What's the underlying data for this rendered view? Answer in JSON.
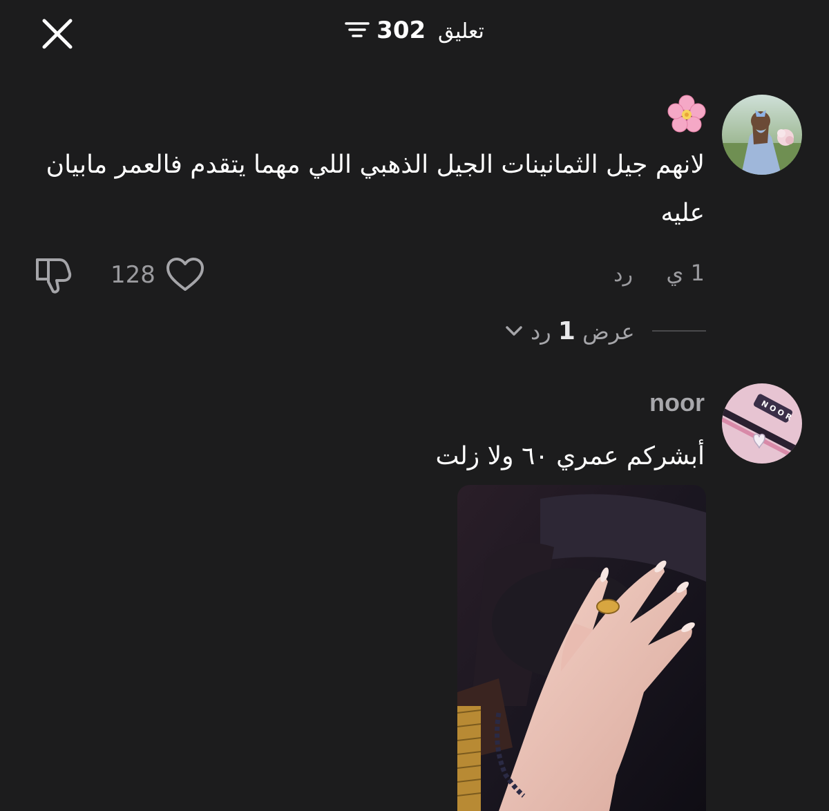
{
  "header": {
    "count": "302",
    "title_word": "تعليق"
  },
  "comments": [
    {
      "emoji": "🌸",
      "text": "لانهم جيل الثمانينات الجيل الذهبي اللي مهما يتقدم فالعمر مابيان عليه",
      "time": "1 ي",
      "reply_label": "رد",
      "like_count": "128",
      "view_replies_prefix": "عرض",
      "view_replies_count": "1",
      "view_replies_suffix": "رد"
    },
    {
      "username": "noor",
      "text": "أبشركم عمري ٦٠ ولا زلت"
    }
  ],
  "colors": {
    "background": "#1c1c1d",
    "text": "#ffffff",
    "secondary": "#9b9b9f"
  },
  "icons": [
    "close-icon",
    "sort-icon",
    "heart-icon",
    "thumbs-down-icon",
    "chevron-down-icon"
  ]
}
